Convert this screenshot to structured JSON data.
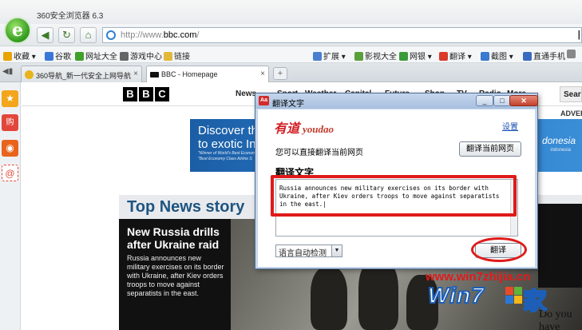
{
  "browser": {
    "window_title": "360安全浏览器 6.3",
    "logo_glyph": "e",
    "nav": {
      "back": "◀",
      "refresh": "↻",
      "home": "⌂"
    },
    "address": {
      "prefix": "http://www.",
      "domain": "bbc.com",
      "suffix": "/",
      "go": "|"
    },
    "favorites_left": [
      {
        "label": "收藏",
        "icon": "star-icon",
        "color": "#e8a400"
      },
      {
        "label": "谷歌",
        "icon": "google-icon",
        "color": "#3a77d8"
      },
      {
        "label": "网址大全",
        "icon": "e-icon",
        "color": "#3fa02a"
      },
      {
        "label": "游戏中心",
        "icon": "gamepad-icon",
        "color": "#666666"
      },
      {
        "label": "链接",
        "icon": "folder-icon",
        "color": "#e2b83a"
      }
    ],
    "favorites_right": [
      {
        "label": "扩展",
        "icon": "grid-icon",
        "color": "#4a7fd0"
      },
      {
        "label": "影视大全",
        "icon": "play-icon",
        "color": "#5aa03a"
      },
      {
        "label": "网银",
        "icon": "shield-icon",
        "color": "#3a9a3a"
      },
      {
        "label": "翻译",
        "icon": "translate-icon",
        "color": "#d93a2a"
      },
      {
        "label": "截图",
        "icon": "scissors-icon",
        "color": "#3a7ad0"
      },
      {
        "label": "直通手机",
        "icon": "phone-icon",
        "color": "#3a6ac0"
      }
    ],
    "tabs": [
      {
        "label": "360导航_新一代安全上网导航",
        "icon": "360-icon",
        "close": "×"
      },
      {
        "label": "BBC - Homepage",
        "icon": "bbc-icon",
        "close": "×"
      }
    ],
    "newtab": "+"
  },
  "sidebar": {
    "items": [
      {
        "icon": "star-icon",
        "glyph": "★",
        "color": "#f3a51b"
      },
      {
        "icon": "shopping-icon",
        "glyph": "购",
        "color": "#e2463a"
      },
      {
        "icon": "weibo-icon",
        "glyph": "◉",
        "color": "#e8641d"
      },
      {
        "icon": "email-icon",
        "glyph": "@",
        "color": "#e24a3a"
      }
    ]
  },
  "page": {
    "bbc_letters": [
      "B",
      "B",
      "C"
    ],
    "nav_items": [
      "News",
      "Sport",
      "Weather",
      "Capital",
      "Future",
      "Shop",
      "TV",
      "Radio",
      "More..."
    ],
    "search": "Search",
    "advert": "ADVERT",
    "ad_headline": "Discover the\nto exotic In",
    "ad_small": "\"Winner of World's Best Economy\n\"Best Economy Class Airline S",
    "ad_right": "donesia",
    "ad_right_small": "indonesia",
    "top_news": "Top News story",
    "story_headline": "New Russia drills after Ukraine raid",
    "story_body": "Russia announces new military exercises on its border with Ukraine, after Kiev orders troops to move against separatists in the east.",
    "side_text": "Do you have"
  },
  "dialog": {
    "title": "翻译文字",
    "logo_youdao": "有道",
    "logo_youdao_latin": "youdao",
    "settings": "设置",
    "hint": "您可以直接翻译当前网页",
    "translate_page_button": "翻译当前网页",
    "section_title": "翻译文字",
    "input_text": "Russia announces new military exercises on its border with Ukraine, after Kiev orders troops to move against separatists in the east.|",
    "language_select": "语言自动检测",
    "translate_button": "翻译",
    "win_min": "_",
    "win_max": "□",
    "win_close": "✕"
  },
  "watermark": {
    "url": "www.win7zhijia.cn",
    "brand": "Win7",
    "suffix": "家"
  }
}
